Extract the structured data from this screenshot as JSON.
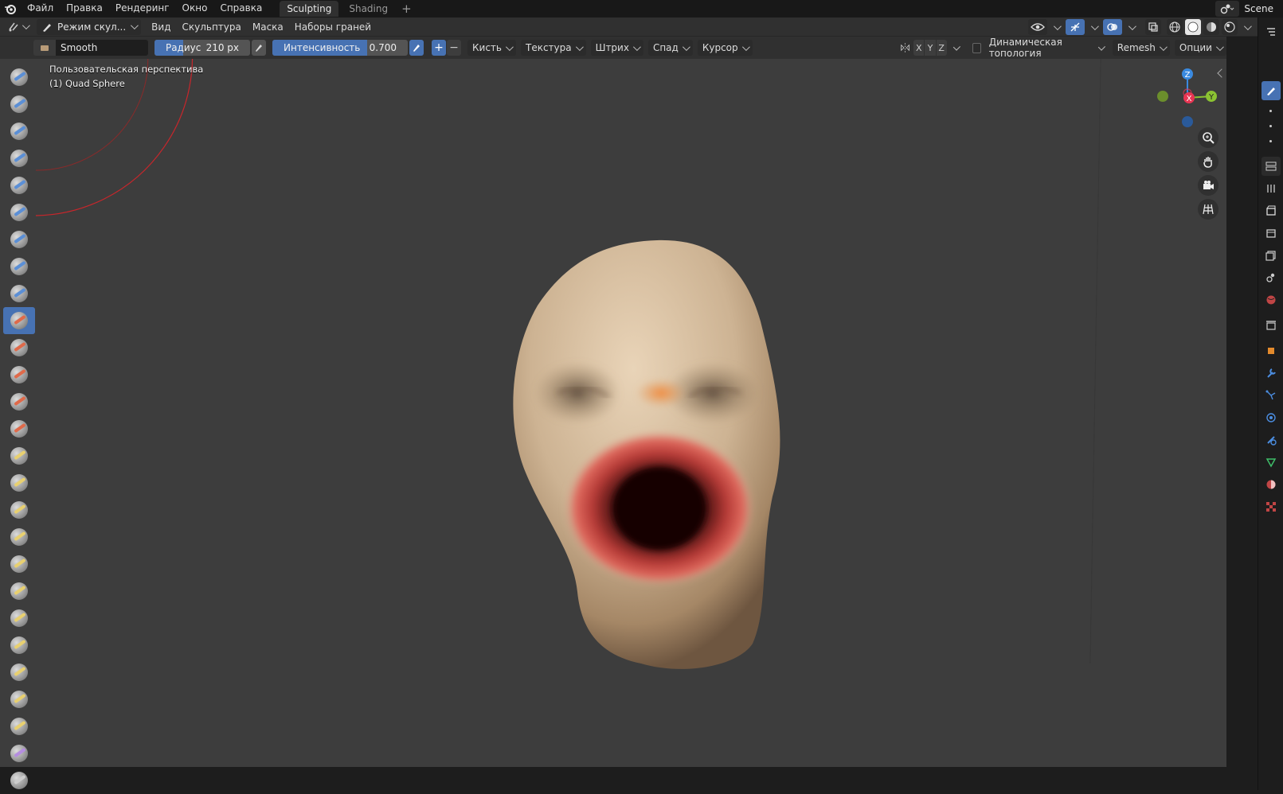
{
  "topbar": {
    "menus": [
      "Файл",
      "Правка",
      "Рендеринг",
      "Окно",
      "Справка"
    ],
    "workspaces": [
      {
        "label": "Sculpting",
        "active": true
      },
      {
        "label": "Shading",
        "active": false
      }
    ],
    "add_workspace": "+",
    "scene_name": "Scene"
  },
  "header1": {
    "mode_label": "Режим скул...",
    "menus": [
      "Вид",
      "Скульптура",
      "Маска",
      "Наборы граней"
    ]
  },
  "header2": {
    "brush_name": "Smooth",
    "radius_label": "Радиус",
    "radius_value": "210 px",
    "radius_fraction": 0.3,
    "strength_label": "Интенсивность",
    "strength_value": "0.700",
    "strength_fraction": 0.7,
    "plus": "+",
    "minus": "−",
    "dropdowns": [
      "Кисть",
      "Текстура",
      "Штрих",
      "Спад",
      "Курсор"
    ],
    "axes": [
      "X",
      "Y",
      "Z"
    ],
    "dyntopo_label": "Динамическая топология",
    "remesh_label": "Remesh",
    "options_label": "Опции"
  },
  "viewport": {
    "view_name": "Пользовательская перспектива",
    "object_name": "(1) Quad Sphere",
    "gizmo": {
      "z": "Z",
      "y": "Y",
      "x": "X"
    },
    "colors": {
      "x": "#e83553",
      "y": "#8bc232",
      "z": "#3a8ae0",
      "cursor_ring": "#c8262b"
    }
  },
  "toolbar": {
    "active_index": 9,
    "tools": [
      "draw",
      "draw-sharp",
      "clay",
      "clay-strips",
      "clay-thumb",
      "layer",
      "inflate",
      "blob",
      "crease",
      "smooth",
      "flatten",
      "fill",
      "scrape",
      "multiplane-scrape",
      "pinch",
      "grab",
      "elastic-deform",
      "snake-hook",
      "thumb",
      "pose",
      "nudge",
      "rotate",
      "slide-relax",
      "boundary",
      "cloth",
      "simplify",
      "mask"
    ]
  },
  "accent": "#4772b3"
}
